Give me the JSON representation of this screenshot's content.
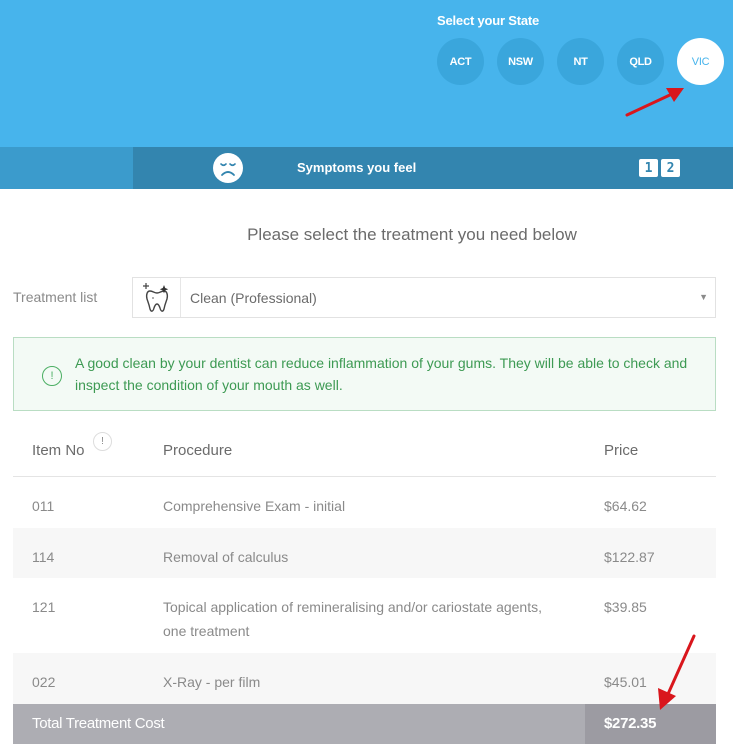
{
  "header": {
    "state_label": "Select your State",
    "states": [
      {
        "code": "ACT",
        "active": false
      },
      {
        "code": "NSW",
        "active": false
      },
      {
        "code": "NT",
        "active": false
      },
      {
        "code": "QLD",
        "active": false
      },
      {
        "code": "VIC",
        "active": true
      }
    ]
  },
  "stepbar": {
    "icon": "sad-face-icon",
    "title": "Symptoms you feel",
    "steps": [
      "1",
      "2"
    ]
  },
  "main": {
    "heading": "Please select the treatment you need below",
    "treatment": {
      "label": "Treatment list",
      "icon": "tooth-sparkle-icon",
      "selected": "Clean (Professional)"
    },
    "info": {
      "icon": "info-exclamation-icon",
      "text": "A good clean by your dentist can reduce inflammation of your gums. They will be able to check and inspect the condition of your mouth as well."
    },
    "table": {
      "columns": {
        "item": "Item No",
        "item_info": "!",
        "procedure": "Procedure",
        "price": "Price"
      },
      "rows": [
        {
          "item": "011",
          "procedure": "Comprehensive Exam - initial",
          "price": "$64.62"
        },
        {
          "item": "114",
          "procedure": "Removal of calculus",
          "price": "$122.87"
        },
        {
          "item": "121",
          "procedure": "Topical application of remineralising and/or cariostate agents, one treatment",
          "price": "$39.85"
        },
        {
          "item": "022",
          "procedure": "X-Ray - per film",
          "price": "$45.01"
        }
      ],
      "total_label": "Total Treatment Cost",
      "total_price": "$272.35"
    }
  },
  "colors": {
    "header_blue": "#47b4ec",
    "stepbar_blue": "#3385af",
    "info_green": "#3d9a53",
    "total_gray": "#adadb3",
    "annotation_red": "#d9161c"
  }
}
